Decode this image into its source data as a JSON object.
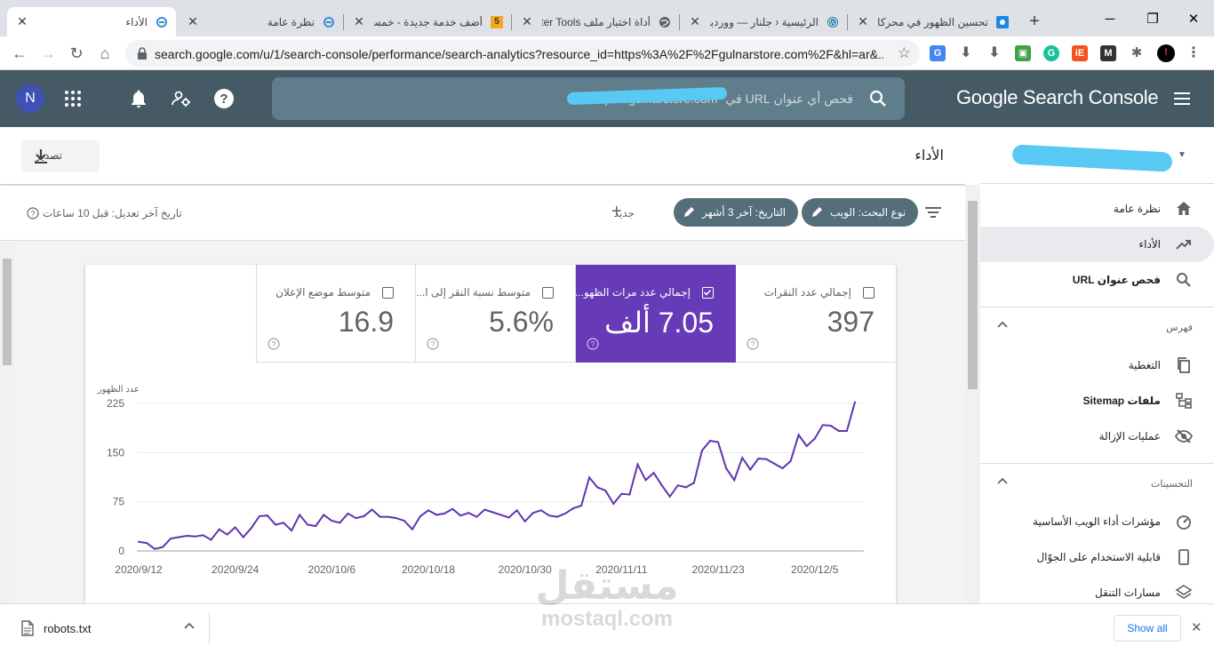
{
  "browser": {
    "tabs": [
      {
        "title": "الأداء",
        "active": true,
        "favicon": "gsc-icon"
      },
      {
        "title": "نظرة عامة",
        "active": false,
        "favicon": "gsc-icon"
      },
      {
        "title": "أضف خدمة جديدة - خمسات",
        "active": false,
        "favicon": "khamsat-icon"
      },
      {
        "title": "أداة اختبار ملف Tester Tools",
        "active": false,
        "favicon": "globe-icon"
      },
      {
        "title": "الرئيسية ‹ جلنار — ووردبريس",
        "active": false,
        "favicon": "wordpress-icon"
      },
      {
        "title": "تحسين الظهور في محركات البحث",
        "active": false,
        "favicon": "seo-icon"
      }
    ],
    "url": "search.google.com/u/1/search-console/performance/search-analytics?resource_id=https%3A%2F%2Fgulnarstore.com%2F&hl=ar&..."
  },
  "header": {
    "avatar_letter": "N",
    "search_placeholder": "فحص أي عنوان URL في \"https://gulnarstore.com\"",
    "brand": "Google Search Console"
  },
  "main": {
    "page_title": "الأداء",
    "export_label": "تصدير",
    "chips": [
      "نوع البحث: الويب",
      "التاريخ: آخر 3 أشهر"
    ],
    "new_label": "جديد",
    "last_updated": "تاريخ آخر تعديل: قبل 10 ساعات"
  },
  "metrics": [
    {
      "label": "إجمالي عدد النقرات",
      "value": "397",
      "selected": false
    },
    {
      "label": "إجمالي عدد مرات الظهو...",
      "value": "7.05 ألف",
      "selected": true
    },
    {
      "label": "متوسط نسبة النقر إلى ا...",
      "value": "5.6%",
      "selected": false
    },
    {
      "label": "متوسط موضع الإعلان",
      "value": "16.9",
      "selected": false
    }
  ],
  "chart_data": {
    "type": "line",
    "ylabel": "عدد الظهور",
    "ylim": [
      0,
      225
    ],
    "yticks": [
      0,
      75,
      150,
      225
    ],
    "x_tick_labels": [
      "2020/9/12",
      "2020/9/24",
      "2020/10/6",
      "2020/10/18",
      "2020/10/30",
      "2020/11/11",
      "2020/11/23",
      "2020/12/5"
    ],
    "x_start": "2020/9/12",
    "color": "#5e35b1",
    "series": [
      {
        "values": [
          14,
          12,
          3,
          6,
          19,
          21,
          23,
          22,
          24,
          17,
          33,
          25,
          36,
          21,
          35,
          53,
          54,
          40,
          43,
          31,
          55,
          40,
          38,
          55,
          46,
          43,
          57,
          50,
          53,
          63,
          52,
          52,
          50,
          46,
          33,
          53,
          62,
          55,
          57,
          64,
          54,
          58,
          52,
          63,
          59,
          55,
          51,
          62,
          45,
          58,
          62,
          54,
          52,
          57,
          65,
          69,
          112,
          97,
          92,
          72,
          87,
          86,
          132,
          108,
          119,
          100,
          83,
          100,
          97,
          104,
          153,
          168,
          166,
          126,
          108,
          142,
          124,
          141,
          140,
          133,
          126,
          137,
          177,
          160,
          171,
          192,
          191,
          183,
          183,
          227
        ]
      }
    ]
  },
  "sidebar": {
    "items": [
      {
        "label": "نظرة عامة",
        "icon": "home-icon",
        "active": false
      },
      {
        "label": "الأداء",
        "icon": "trending-up-icon",
        "active": true
      },
      {
        "label": "فحص عنوان URL",
        "icon": "search-icon",
        "active": false
      }
    ],
    "index_section": "فهرس",
    "index_items": [
      {
        "label": "التغطية",
        "icon": "copy-icon"
      },
      {
        "label": "ملفات Sitemap",
        "icon": "sitemap-icon"
      },
      {
        "label": "عمليات الإزالة",
        "icon": "eye-off-icon"
      }
    ],
    "enhancements_section": "التحسينات",
    "enhancement_items": [
      {
        "label": "مؤشرات أداء الويب الأساسية",
        "icon": "speed-icon"
      },
      {
        "label": "قابلية الاستخدام على الجوّال",
        "icon": "phone-icon"
      },
      {
        "label": "مسارات التنقل",
        "icon": "layers-icon"
      }
    ]
  },
  "downloads": {
    "file_name": "robots.txt",
    "show_all": "Show all"
  },
  "watermark": {
    "arabic": "مستقل",
    "latin": "mostaql.com"
  }
}
